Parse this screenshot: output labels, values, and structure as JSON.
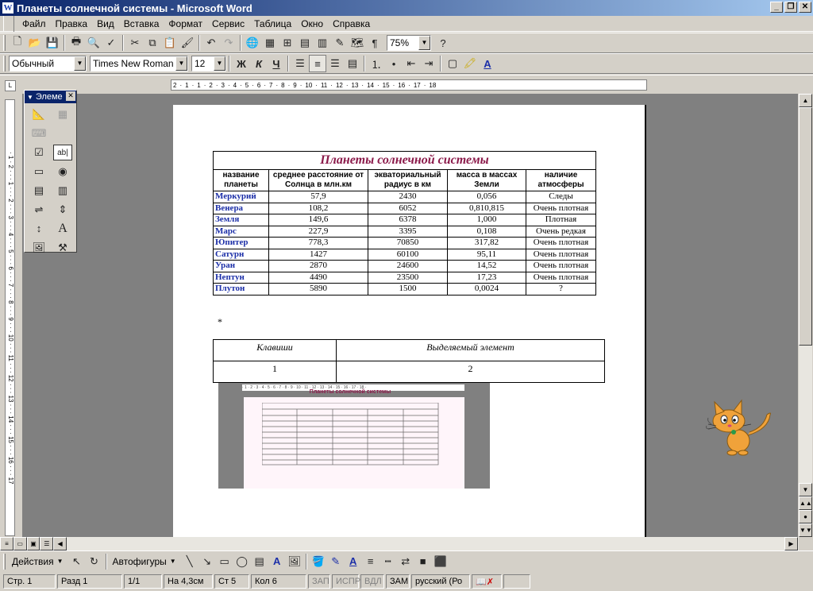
{
  "window": {
    "title": "Планеты солнечной системы - Microsoft Word"
  },
  "menu": [
    "Файл",
    "Правка",
    "Вид",
    "Вставка",
    "Формат",
    "Сервис",
    "Таблица",
    "Окно",
    "Справка"
  ],
  "standard_toolbar": {
    "zoom": "75%"
  },
  "format_toolbar": {
    "style": "Обычный",
    "font": "Times New Roman",
    "size": "12",
    "bold": "Ж",
    "italic": "К",
    "underline": "Ч"
  },
  "forms_toolbar": {
    "title": "Элеме"
  },
  "ruler": {
    "marks": [
      "2",
      "1",
      "1",
      "2",
      "3",
      "4",
      "5",
      "6",
      "7",
      "8",
      "9",
      "10",
      "11",
      "12",
      "13",
      "14",
      "15",
      "16",
      "17",
      "18"
    ]
  },
  "planet_table": {
    "caption": "Планеты солнечной системы",
    "headers": [
      "название планеты",
      "среднее расстояние от Солнца в млн.км",
      "экваториальный радиус в км",
      "масса в массах Земли",
      "наличие атмосферы"
    ],
    "rows": [
      [
        "Меркурий",
        "57,9",
        "2430",
        "0,056",
        "Следы"
      ],
      [
        "Венера",
        "108,2",
        "6052",
        "0,810,815",
        "Очень плотная"
      ],
      [
        "Земля",
        "149,6",
        "6378",
        "1,000",
        "Плотная"
      ],
      [
        "Марс",
        "227,9",
        "3395",
        "0,108",
        "Очень редкая"
      ],
      [
        "Юпитер",
        "778,3",
        "70850",
        "317,82",
        "Очень плотная"
      ],
      [
        "Сатурн",
        "1427",
        "60100",
        "95,11",
        "Очень плотная"
      ],
      [
        "Уран",
        "2870",
        "24600",
        "14,52",
        "Очень плотная"
      ],
      [
        "Нептун",
        "4490",
        "23500",
        "17,23",
        "Очень плотная"
      ],
      [
        "Плутон",
        "5890",
        "1500",
        "0,0024",
        "?"
      ]
    ]
  },
  "star": "*",
  "keys_table": {
    "headers": [
      "Клавиши",
      "Выделяемый элемент"
    ],
    "values": [
      "1",
      "2"
    ]
  },
  "thumbnail": {
    "title": "Планеты солнечной системы"
  },
  "drawing_toolbar": {
    "actions": "Действия",
    "autoshapes": "Автофигуры"
  },
  "status": {
    "page": "Стр. 1",
    "section": "Разд 1",
    "pages": "1/1",
    "at": "На 4,3см",
    "line": "Ст 5",
    "col": "Кол 6",
    "rec": "ЗАП",
    "trk": "ИСПР",
    "ext": "ВДЛ",
    "ovr": "ЗАМ",
    "lang": "русский (Ро"
  }
}
